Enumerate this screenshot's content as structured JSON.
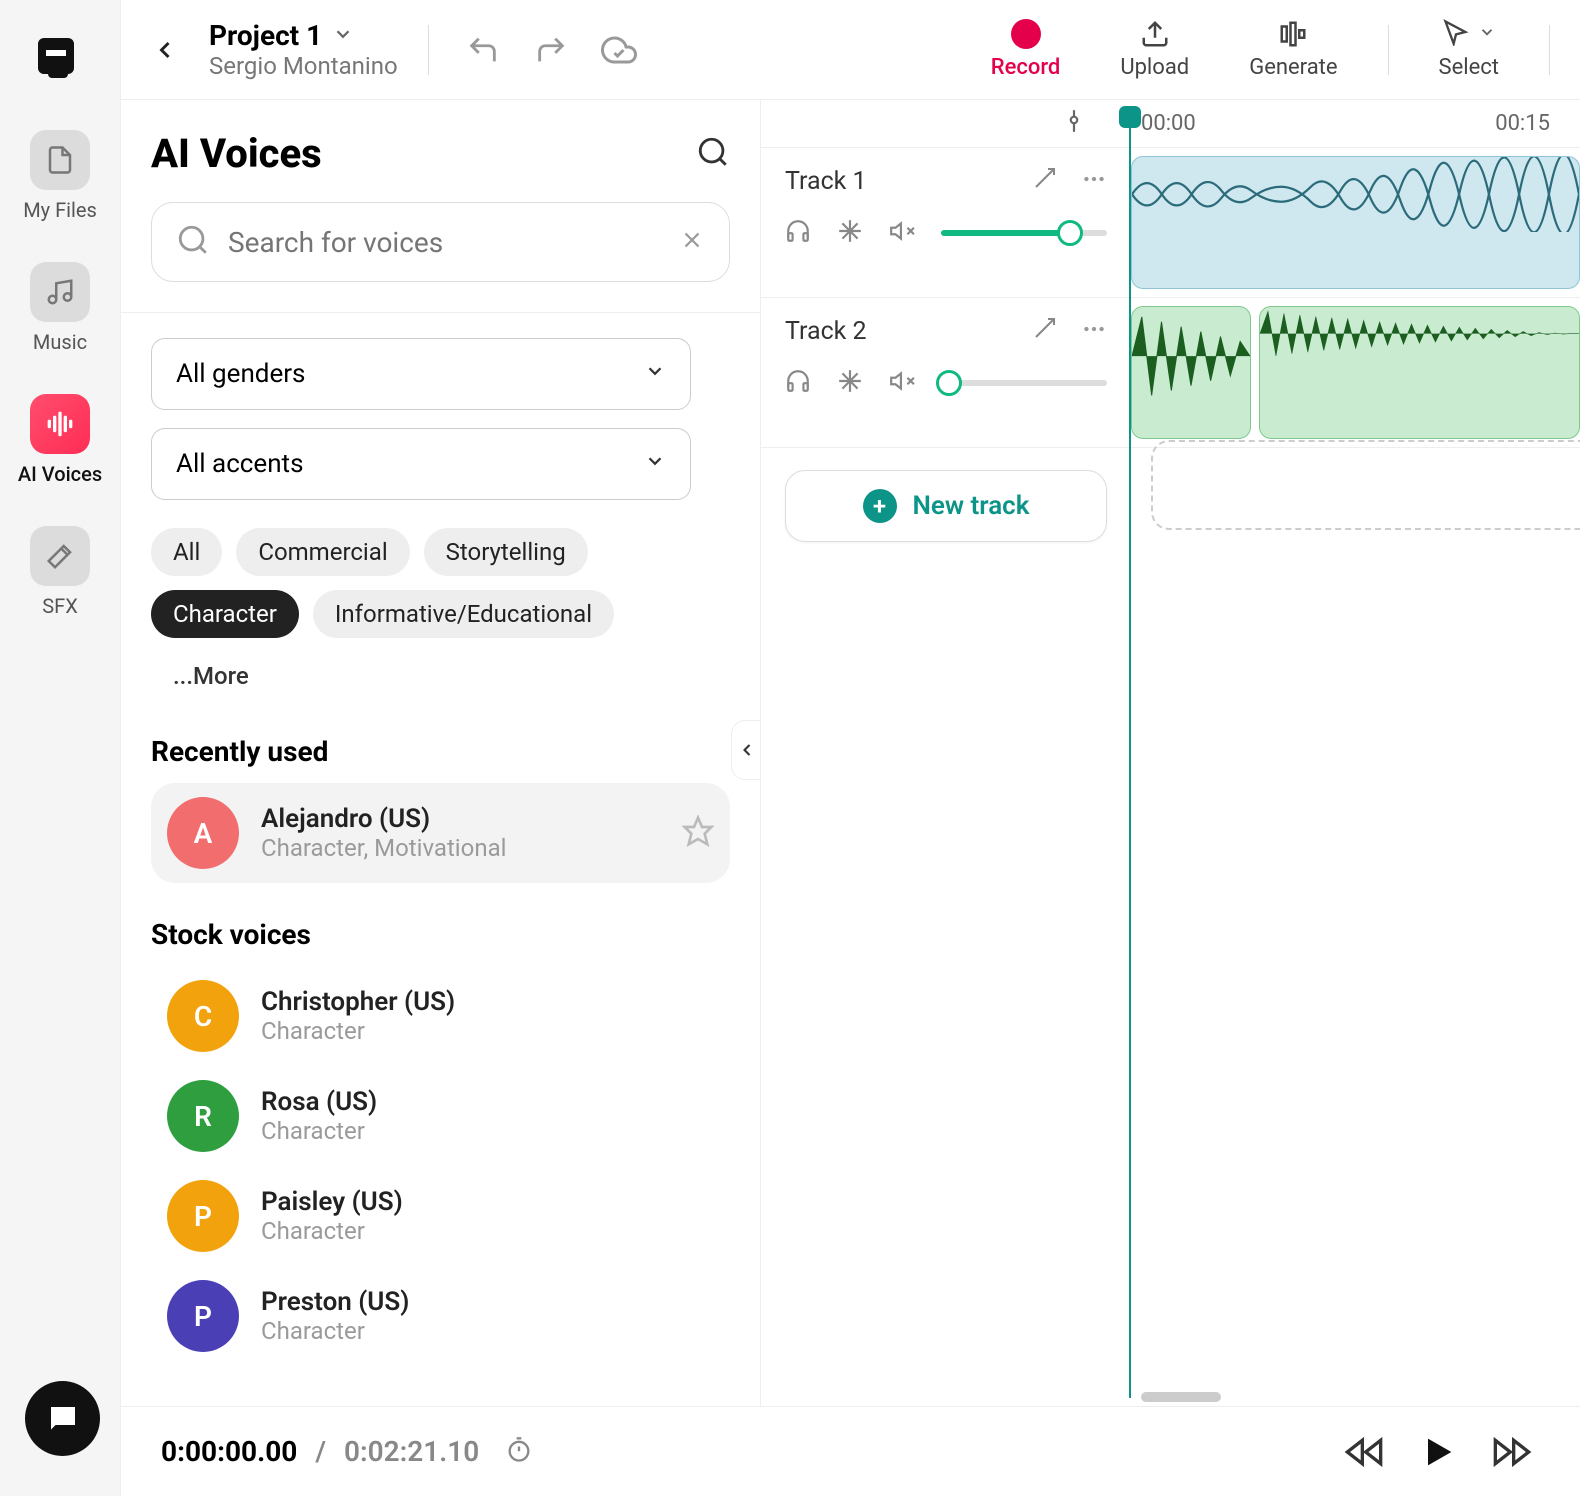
{
  "rail": {
    "items": [
      {
        "label": "My Files"
      },
      {
        "label": "Music"
      },
      {
        "label": "AI Voices"
      },
      {
        "label": "SFX"
      }
    ]
  },
  "header": {
    "project_title": "Project 1",
    "user": "Sergio Montanino",
    "actions": {
      "record": "Record",
      "upload": "Upload",
      "generate": "Generate",
      "select": "Select"
    }
  },
  "voices": {
    "title": "AI Voices",
    "search_placeholder": "Search for voices",
    "gender_select": "All genders",
    "accent_select": "All accents",
    "chips": [
      "All",
      "Commercial",
      "Storytelling",
      "Character",
      "Informative/Educational"
    ],
    "chips_more": "...More",
    "active_chip_index": 3,
    "recent_header": "Recently used",
    "recent": [
      {
        "initial": "A",
        "name": "Alejandro (US)",
        "sub": "Character, Motivational",
        "color": "#f26d6d"
      }
    ],
    "stock_header": "Stock voices",
    "stock": [
      {
        "initial": "C",
        "name": "Christopher (US)",
        "sub": "Character",
        "color": "#f2a20c"
      },
      {
        "initial": "R",
        "name": "Rosa (US)",
        "sub": "Character",
        "color": "#2e9e3f"
      },
      {
        "initial": "P",
        "name": "Paisley (US)",
        "sub": "Character",
        "color": "#f2a20c"
      },
      {
        "initial": "P",
        "name": "Preston (US)",
        "sub": "Character",
        "color": "#4b3fb5"
      }
    ]
  },
  "timeline": {
    "ticks": [
      "00:00",
      "00:15"
    ],
    "tracks": [
      {
        "name": "Track 1",
        "volume": 0.78
      },
      {
        "name": "Track 2",
        "volume": 0.05
      }
    ],
    "new_track": "New track"
  },
  "transport": {
    "current": "0:00:00.00",
    "separator": " / ",
    "total": "0:02:21.10"
  }
}
